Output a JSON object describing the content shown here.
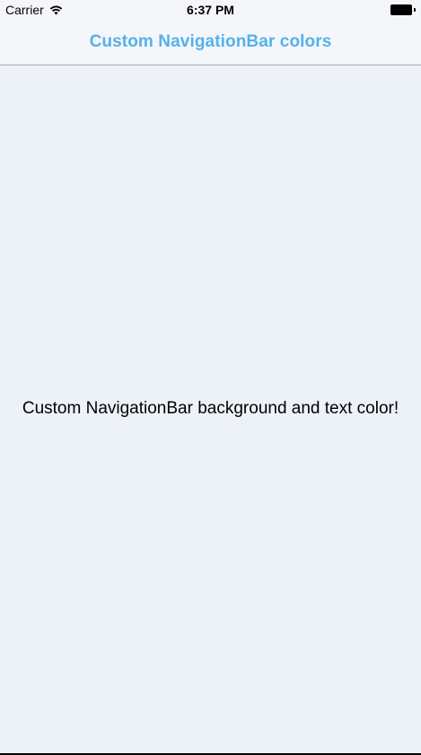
{
  "status_bar": {
    "carrier": "Carrier",
    "time": "6:37 PM",
    "wifi_icon": "wifi-icon",
    "battery_icon": "battery-icon"
  },
  "nav_bar": {
    "title": "Custom NavigationBar colors",
    "title_color": "#56b0ec",
    "background_color": "#f4f6fa"
  },
  "content": {
    "message": "Custom NavigationBar background and text color!",
    "background_color": "#edf2f9"
  }
}
